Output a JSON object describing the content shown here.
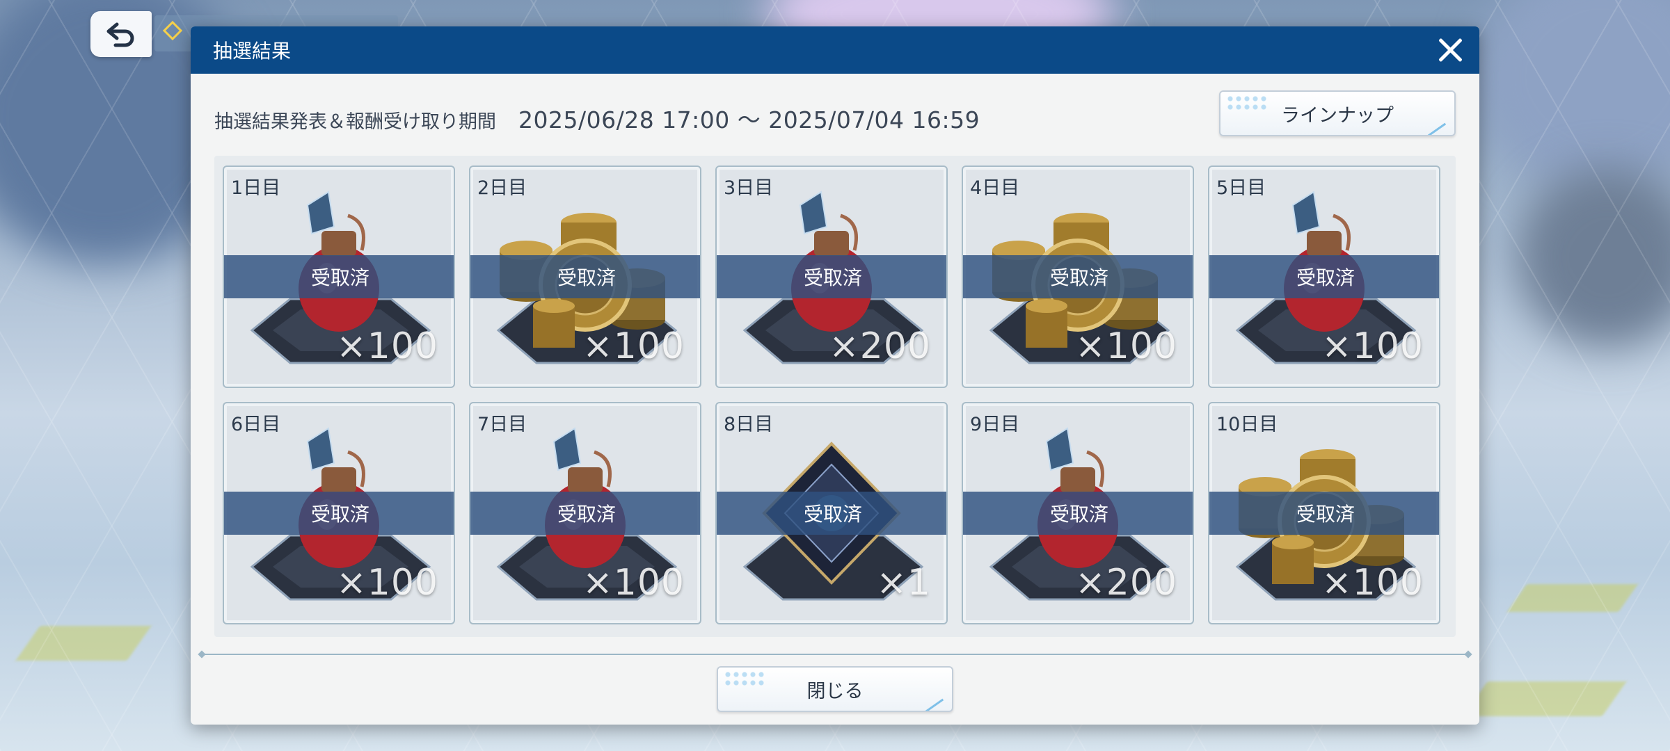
{
  "dialog": {
    "title": "抽選結果",
    "period_label": "抽選結果発表＆報酬受け取り期間",
    "period_dates": "2025/06/28 17:00 ～ 2025/07/04 16:59",
    "lineup_label": "ラインナップ",
    "close_label": "閉じる"
  },
  "rewards": [
    {
      "day": "1日目",
      "status": "受取済",
      "qty": "×100",
      "icon": "potion-icon"
    },
    {
      "day": "2日目",
      "status": "受取済",
      "qty": "×100",
      "icon": "coins-icon"
    },
    {
      "day": "3日目",
      "status": "受取済",
      "qty": "×200",
      "icon": "potion-icon"
    },
    {
      "day": "4日目",
      "status": "受取済",
      "qty": "×100",
      "icon": "coins-icon"
    },
    {
      "day": "5日目",
      "status": "受取済",
      "qty": "×100",
      "icon": "potion-icon"
    },
    {
      "day": "6日目",
      "status": "受取済",
      "qty": "×100",
      "icon": "potion-icon"
    },
    {
      "day": "7日目",
      "status": "受取済",
      "qty": "×100",
      "icon": "potion-icon"
    },
    {
      "day": "8日目",
      "status": "受取済",
      "qty": "×1",
      "icon": "ticket-icon"
    },
    {
      "day": "9日目",
      "status": "受取済",
      "qty": "×200",
      "icon": "potion-icon"
    },
    {
      "day": "10日目",
      "status": "受取済",
      "qty": "×100",
      "icon": "coins-icon"
    }
  ],
  "colors": {
    "header": "#0b4a88",
    "band": "#305280",
    "panel": "#f3f4f4"
  }
}
